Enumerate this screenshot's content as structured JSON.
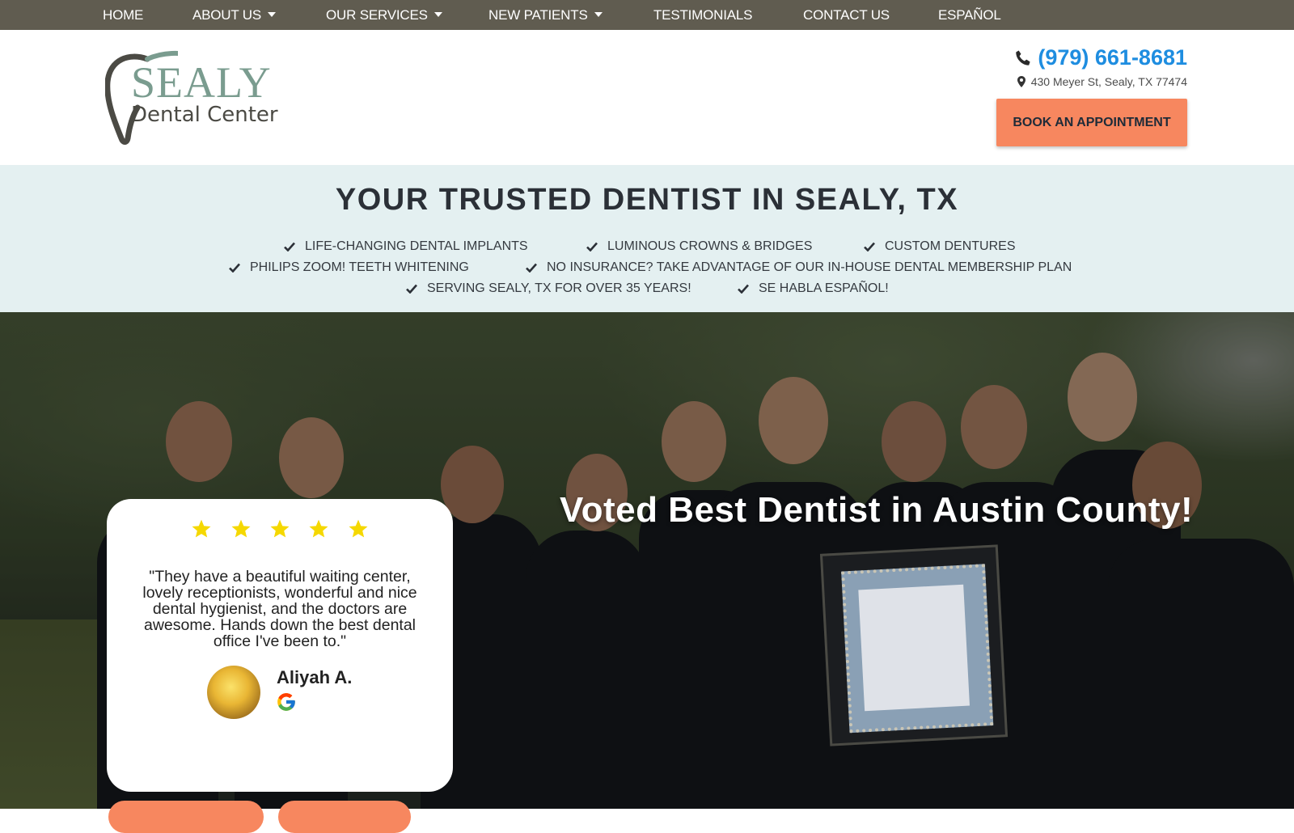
{
  "nav": {
    "items": [
      {
        "label": "HOME",
        "dropdown": false
      },
      {
        "label": "ABOUT US",
        "dropdown": true
      },
      {
        "label": "OUR SERVICES",
        "dropdown": true
      },
      {
        "label": "NEW PATIENTS",
        "dropdown": true
      },
      {
        "label": "TESTIMONIALS",
        "dropdown": false
      },
      {
        "label": "CONTACT US",
        "dropdown": false
      },
      {
        "label": "ESPAÑOL",
        "dropdown": false
      }
    ]
  },
  "header": {
    "logo_top": "SEALY",
    "logo_bottom": "Dental Center",
    "phone": "(979) 661-8681",
    "address": "430 Meyer St, Sealy, TX 77474",
    "book_label": "BOOK AN APPOINTMENT"
  },
  "band": {
    "title": "YOUR TRUSTED DENTIST IN SEALY, TX",
    "benefits": [
      "LIFE-CHANGING DENTAL IMPLANTS",
      "LUMINOUS CROWNS & BRIDGES",
      "CUSTOM DENTURES",
      "PHILIPS ZOOM! TEETH WHITENING",
      "NO INSURANCE? TAKE ADVANTAGE OF OUR IN-HOUSE DENTAL MEMBERSHIP PLAN",
      "SERVING SEALY, TX FOR OVER 35 YEARS!",
      "SE HABLA ESPAÑOL!"
    ]
  },
  "hero": {
    "title": "Voted Best Dentist in Austin County!"
  },
  "review": {
    "rating": 5,
    "quote": "\"They have a beautiful waiting center, lovely receptionists, wonderful and nice dental hygienist, and the doctors are awesome. Hands down the best dental office I've been to.\"",
    "reviewer": "Aliyah A."
  },
  "colors": {
    "nav_bg": "#605c50",
    "accent": "#f7875f",
    "phone": "#1e8de0",
    "band_bg": "#e4f0f1",
    "star": "#f5d800"
  }
}
